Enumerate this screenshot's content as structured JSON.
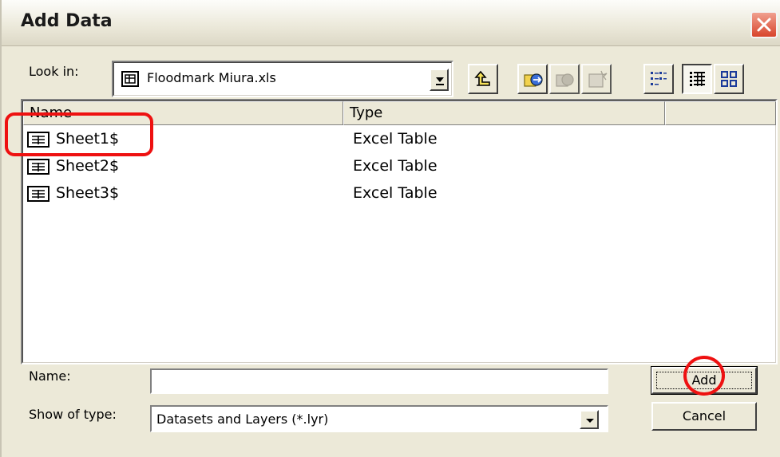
{
  "dialog": {
    "title": "Add Data"
  },
  "look_in": {
    "label": "Look in:",
    "value": "Floodmark Miura.xls"
  },
  "toolbar": {
    "buttons": [
      "up-one-level-icon",
      "connect-folder-icon",
      "disconnect-folder-icon",
      "new-item-icon",
      "list-view-icon",
      "details-view-icon",
      "thumbnails-view-icon"
    ]
  },
  "list": {
    "columns": [
      "Name",
      "Type"
    ],
    "rows": [
      {
        "name": "Sheet1$",
        "type": "Excel Table"
      },
      {
        "name": "Sheet2$",
        "type": "Excel Table"
      },
      {
        "name": "Sheet3$",
        "type": "Excel Table"
      }
    ]
  },
  "name_field": {
    "label": "Name:",
    "value": ""
  },
  "show_of_type": {
    "label": "Show of type:",
    "value": "Datasets and Layers (*.lyr)"
  },
  "buttons": {
    "add": "Add",
    "cancel": "Cancel"
  },
  "colors": {
    "annotation": "#ee1111",
    "dialog_bg": "#ece9d8"
  }
}
